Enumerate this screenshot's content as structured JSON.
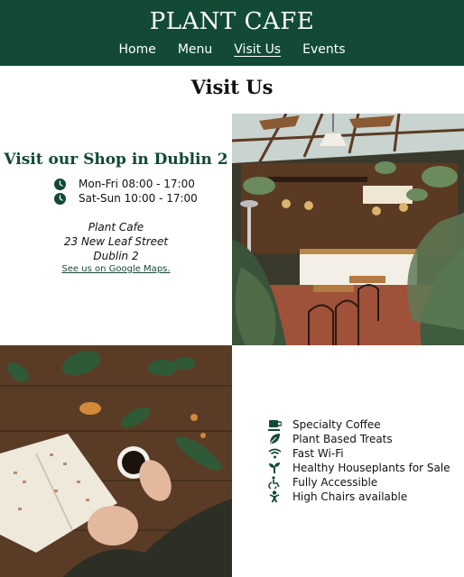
{
  "header": {
    "brand": "PLANT CAFE",
    "nav": [
      {
        "label": "Home",
        "active": false
      },
      {
        "label": "Menu",
        "active": false
      },
      {
        "label": "Visit Us",
        "active": true
      },
      {
        "label": "Events",
        "active": false
      }
    ]
  },
  "page": {
    "title": "Visit Us"
  },
  "visit": {
    "heading": "Visit our Shop in Dublin 2",
    "hours": [
      {
        "label": "Mon-Fri 08:00 - 17:00",
        "icon": "clock-icon"
      },
      {
        "label": "Sat-Sun 10:00 - 17:00",
        "icon": "clock-icon"
      }
    ],
    "address": [
      "Plant Cafe",
      "23 New Leaf Street",
      "Dublin 2"
    ],
    "maps_link": "See us on Google Maps."
  },
  "features": [
    {
      "label": "Specialty Coffee",
      "icon": "coffee-icon"
    },
    {
      "label": "Plant Based Treats",
      "icon": "leaf-icon"
    },
    {
      "label": "Fast Wi-Fi",
      "icon": "wifi-icon"
    },
    {
      "label": "Healthy Houseplants for Sale",
      "icon": "seedling-icon"
    },
    {
      "label": "Fully Accessible",
      "icon": "wheelchair-icon"
    },
    {
      "label": "High Chairs available",
      "icon": "baby-icon"
    }
  ],
  "colors": {
    "brand_green": "#124a36",
    "background": "#ffffff"
  }
}
